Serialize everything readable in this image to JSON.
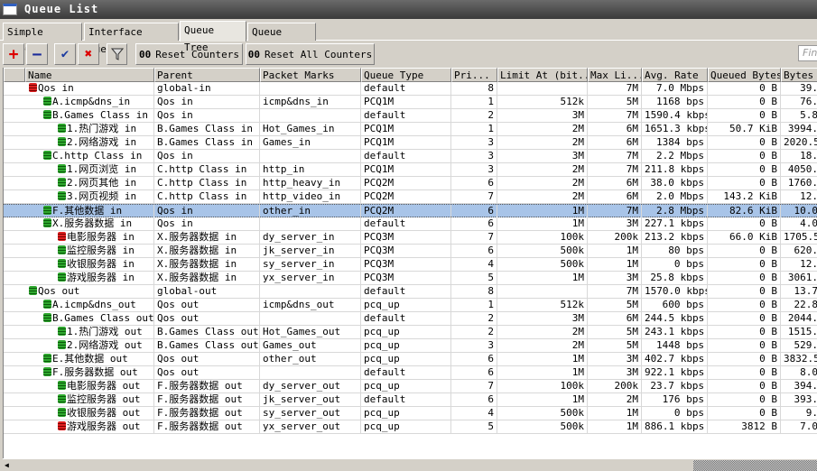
{
  "window": {
    "title": "Queue List"
  },
  "tabs": [
    {
      "label": "Simple Queues"
    },
    {
      "label": "Interface Queues"
    },
    {
      "label": "Queue Tree",
      "active": true
    },
    {
      "label": "Queue Types"
    }
  ],
  "toolbar": {
    "add": "+",
    "remove": "−",
    "enable": "✔",
    "disable": "✖",
    "filter": "filter",
    "reset_counters": "Reset Counters",
    "reset_all_counters": "Reset All Counters",
    "oo": "00",
    "find_placeholder": "Find"
  },
  "columns": [
    "Name",
    "Parent",
    "Packet Marks",
    "Queue Type",
    "Pri...",
    "Limit At (bit...",
    "Max Li...",
    "Avg. Rate",
    "Queued Bytes",
    "Bytes"
  ],
  "rows": [
    {
      "name": "Qos in",
      "parent": "global-in",
      "marks": "",
      "type": "default",
      "pri": "8",
      "limit": "",
      "max": "7M",
      "avg": "7.0 Mbps",
      "queued": "0 B",
      "bytes": "39.",
      "level": 0,
      "icon": "red"
    },
    {
      "name": "A.icmp&dns_in",
      "parent": "Qos in",
      "marks": "icmp&dns_in",
      "type": "PCQ1M",
      "pri": "1",
      "limit": "512k",
      "max": "5M",
      "avg": "1168 bps",
      "queued": "0 B",
      "bytes": "76.",
      "level": 1,
      "icon": "green"
    },
    {
      "name": "B.Games Class in",
      "parent": "Qos in",
      "marks": "",
      "type": "default",
      "pri": "2",
      "limit": "3M",
      "max": "7M",
      "avg": "1590.4 kbps",
      "queued": "0 B",
      "bytes": "5.8",
      "level": 1,
      "icon": "green"
    },
    {
      "name": "1.热门游戏 in",
      "parent": "B.Games Class in",
      "marks": "Hot_Games_in",
      "type": "PCQ1M",
      "pri": "1",
      "limit": "2M",
      "max": "6M",
      "avg": "1651.3 kbps",
      "queued": "50.7 KiB",
      "bytes": "3994.",
      "level": 2,
      "icon": "green"
    },
    {
      "name": "2.网络游戏 in",
      "parent": "B.Games Class in",
      "marks": "Games_in",
      "type": "PCQ1M",
      "pri": "3",
      "limit": "2M",
      "max": "6M",
      "avg": "1384 bps",
      "queued": "0 B",
      "bytes": "2020.5",
      "level": 2,
      "icon": "green"
    },
    {
      "name": "C.http Class in",
      "parent": "Qos in",
      "marks": "",
      "type": "default",
      "pri": "3",
      "limit": "3M",
      "max": "7M",
      "avg": "2.2 Mbps",
      "queued": "0 B",
      "bytes": "18.",
      "level": 1,
      "icon": "green"
    },
    {
      "name": "1.网页浏览 in",
      "parent": "C.http Class in",
      "marks": "http_in",
      "type": "PCQ1M",
      "pri": "3",
      "limit": "2M",
      "max": "7M",
      "avg": "211.8 kbps",
      "queued": "0 B",
      "bytes": "4050.",
      "level": 2,
      "icon": "green"
    },
    {
      "name": "2.网页其他 in",
      "parent": "C.http Class in",
      "marks": "http_heavy_in",
      "type": "PCQ2M",
      "pri": "6",
      "limit": "2M",
      "max": "6M",
      "avg": "38.0 kbps",
      "queued": "0 B",
      "bytes": "1760.",
      "level": 2,
      "icon": "green"
    },
    {
      "name": "3.网页视频 in",
      "parent": "C.http Class in",
      "marks": "http_video_in",
      "type": "PCQ2M",
      "pri": "7",
      "limit": "2M",
      "max": "6M",
      "avg": "2.0 Mbps",
      "queued": "143.2 KiB",
      "bytes": "12.",
      "level": 2,
      "icon": "green"
    },
    {
      "name": "F.其他数据 in",
      "parent": "Qos in",
      "marks": "other_in",
      "type": "PCQ2M",
      "pri": "6",
      "limit": "1M",
      "max": "7M",
      "avg": "2.8 Mbps",
      "queued": "82.6 KiB",
      "bytes": "10.0",
      "level": 1,
      "icon": "green",
      "selected": true
    },
    {
      "name": "X.服务器数据 in",
      "parent": "Qos in",
      "marks": "",
      "type": "default",
      "pri": "6",
      "limit": "1M",
      "max": "3M",
      "avg": "227.1 kbps",
      "queued": "0 B",
      "bytes": "4.0",
      "level": 1,
      "icon": "green"
    },
    {
      "name": "电影服务器 in",
      "parent": "X.服务器数据 in",
      "marks": "dy_server_in",
      "type": "PCQ3M",
      "pri": "7",
      "limit": "100k",
      "max": "200k",
      "avg": "213.2 kbps",
      "queued": "66.0 KiB",
      "bytes": "1705.5",
      "level": 2,
      "icon": "red"
    },
    {
      "name": "监控服务器 in",
      "parent": "X.服务器数据 in",
      "marks": "jk_server_in",
      "type": "PCQ3M",
      "pri": "6",
      "limit": "500k",
      "max": "1M",
      "avg": "80 bps",
      "queued": "0 B",
      "bytes": "620.",
      "level": 2,
      "icon": "green"
    },
    {
      "name": "收银服务器 in",
      "parent": "X.服务器数据 in",
      "marks": "sy_server_in",
      "type": "PCQ3M",
      "pri": "4",
      "limit": "500k",
      "max": "1M",
      "avg": "0 bps",
      "queued": "0 B",
      "bytes": "12.",
      "level": 2,
      "icon": "green"
    },
    {
      "name": "游戏服务器 in",
      "parent": "X.服务器数据 in",
      "marks": "yx_server_in",
      "type": "PCQ3M",
      "pri": "5",
      "limit": "1M",
      "max": "3M",
      "avg": "25.8 kbps",
      "queued": "0 B",
      "bytes": "3061.",
      "level": 2,
      "icon": "green"
    },
    {
      "name": "Qos out",
      "parent": "global-out",
      "marks": "",
      "type": "default",
      "pri": "8",
      "limit": "",
      "max": "7M",
      "avg": "1570.0 kbps",
      "queued": "0 B",
      "bytes": "13.7",
      "level": 0,
      "icon": "green"
    },
    {
      "name": "A.icmp&dns_out",
      "parent": "Qos out",
      "marks": "icmp&dns_out",
      "type": "pcq_up",
      "pri": "1",
      "limit": "512k",
      "max": "5M",
      "avg": "600 bps",
      "queued": "0 B",
      "bytes": "22.8",
      "level": 1,
      "icon": "green"
    },
    {
      "name": "B.Games Class out",
      "parent": "Qos out",
      "marks": "",
      "type": "default",
      "pri": "2",
      "limit": "3M",
      "max": "6M",
      "avg": "244.5 kbps",
      "queued": "0 B",
      "bytes": "2044.",
      "level": 1,
      "icon": "green"
    },
    {
      "name": "1.热门游戏 out",
      "parent": "B.Games Class out",
      "marks": "Hot_Games_out",
      "type": "pcq_up",
      "pri": "2",
      "limit": "2M",
      "max": "5M",
      "avg": "243.1 kbps",
      "queued": "0 B",
      "bytes": "1515.",
      "level": 2,
      "icon": "green"
    },
    {
      "name": "2.网络游戏 out",
      "parent": "B.Games Class out",
      "marks": "Games_out",
      "type": "pcq_up",
      "pri": "3",
      "limit": "2M",
      "max": "5M",
      "avg": "1448 bps",
      "queued": "0 B",
      "bytes": "529.",
      "level": 2,
      "icon": "green"
    },
    {
      "name": "E.其他数据 out",
      "parent": "Qos out",
      "marks": "other_out",
      "type": "pcq_up",
      "pri": "6",
      "limit": "1M",
      "max": "3M",
      "avg": "402.7 kbps",
      "queued": "0 B",
      "bytes": "3832.5",
      "level": 1,
      "icon": "green"
    },
    {
      "name": "F.服务器数据 out",
      "parent": "Qos out",
      "marks": "",
      "type": "default",
      "pri": "6",
      "limit": "1M",
      "max": "3M",
      "avg": "922.1 kbps",
      "queued": "0 B",
      "bytes": "8.0",
      "level": 1,
      "icon": "green"
    },
    {
      "name": "电影服务器 out",
      "parent": "F.服务器数据 out",
      "marks": "dy_server_out",
      "type": "pcq_up",
      "pri": "7",
      "limit": "100k",
      "max": "200k",
      "avg": "23.7 kbps",
      "queued": "0 B",
      "bytes": "394.",
      "level": 2,
      "icon": "green"
    },
    {
      "name": "监控服务器 out",
      "parent": "F.服务器数据 out",
      "marks": "jk_server_out",
      "type": "default",
      "pri": "6",
      "limit": "1M",
      "max": "2M",
      "avg": "176 bps",
      "queued": "0 B",
      "bytes": "393.",
      "level": 2,
      "icon": "green"
    },
    {
      "name": "收银服务器 out",
      "parent": "F.服务器数据 out",
      "marks": "sy_server_out",
      "type": "pcq_up",
      "pri": "4",
      "limit": "500k",
      "max": "1M",
      "avg": "0 bps",
      "queued": "0 B",
      "bytes": "9.",
      "level": 2,
      "icon": "green"
    },
    {
      "name": "游戏服务器 out",
      "parent": "F.服务器数据 out",
      "marks": "yx_server_out",
      "type": "pcq_up",
      "pri": "5",
      "limit": "500k",
      "max": "1M",
      "avg": "886.1 kbps",
      "queued": "3812 B",
      "bytes": "7.0",
      "level": 2,
      "icon": "red"
    }
  ]
}
